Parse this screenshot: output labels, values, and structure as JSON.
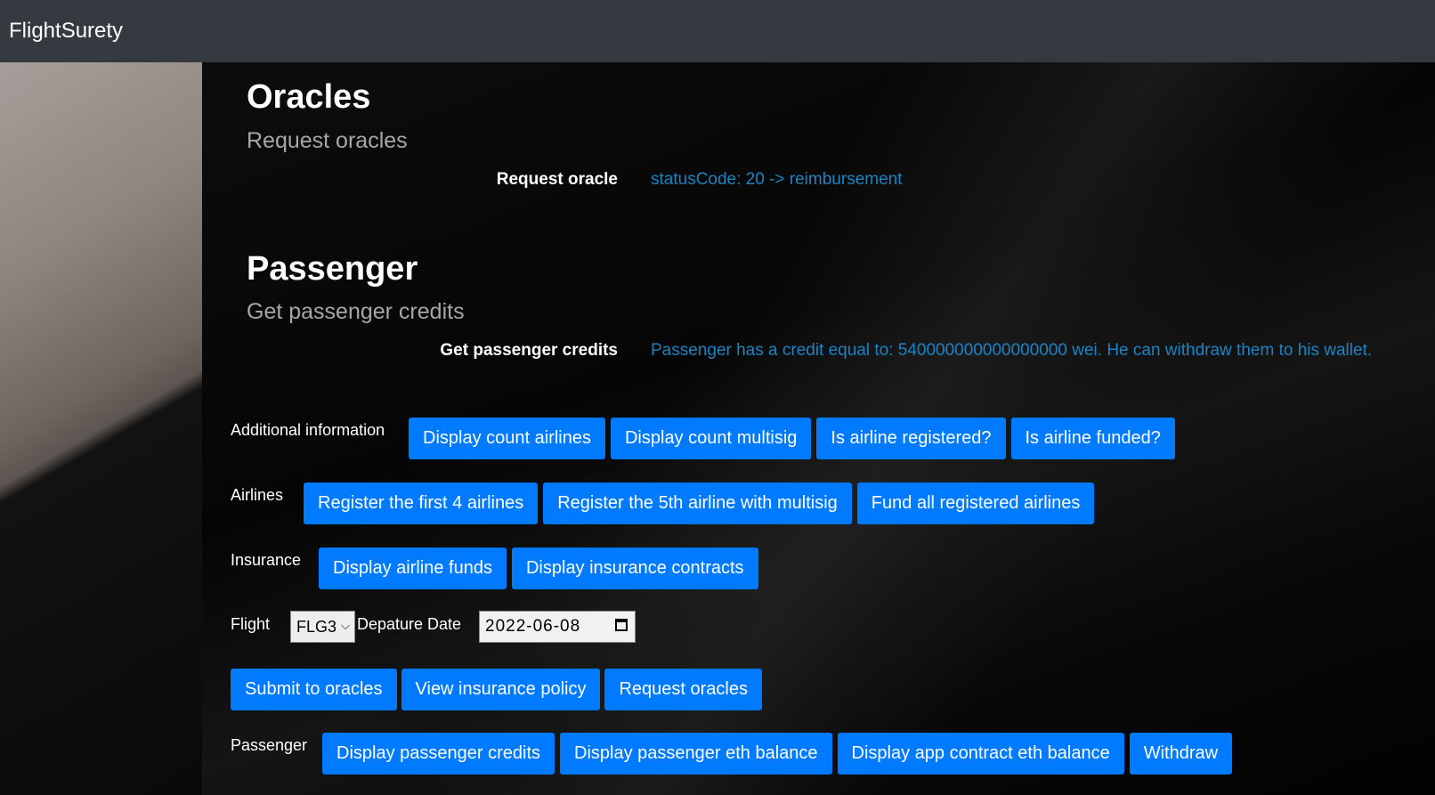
{
  "navbar": {
    "brand": "FlightSurety"
  },
  "oracles": {
    "title": "Oracles",
    "subtitle": "Request oracles",
    "row_label": "Request oracle",
    "status": "statusCode: 20 -> reimbursement"
  },
  "passenger_section": {
    "title": "Passenger",
    "subtitle": "Get passenger credits",
    "row_label": "Get passenger credits",
    "status": "Passenger has a credit equal to: 540000000000000000 wei. He can withdraw them to his wallet."
  },
  "additional": {
    "label": "Additional information",
    "buttons": [
      "Display count airlines",
      "Display count multisig",
      "Is airline registered?",
      "Is airline funded?"
    ]
  },
  "airlines": {
    "label": "Airlines",
    "buttons": [
      "Register the first 4 airlines",
      "Register the 5th airline with multisig",
      "Fund all registered airlines"
    ]
  },
  "insurance": {
    "label": "Insurance",
    "buttons": [
      "Display airline funds",
      "Display insurance contracts"
    ]
  },
  "flight": {
    "label": "Flight",
    "selected": "FLG3",
    "date_label": "Depature Date",
    "date_value": "2022-06-08"
  },
  "oracle_actions": {
    "buttons": [
      "Submit to oracles",
      "View insurance policy",
      "Request oracles"
    ]
  },
  "passenger_actions": {
    "label": "Passenger",
    "buttons": [
      "Display passenger credits",
      "Display passenger eth balance",
      "Display app contract eth balance",
      "Withdraw"
    ]
  },
  "colors": {
    "button": "#007bff",
    "status_text": "#1a84c4",
    "navbar": "#343a40"
  }
}
